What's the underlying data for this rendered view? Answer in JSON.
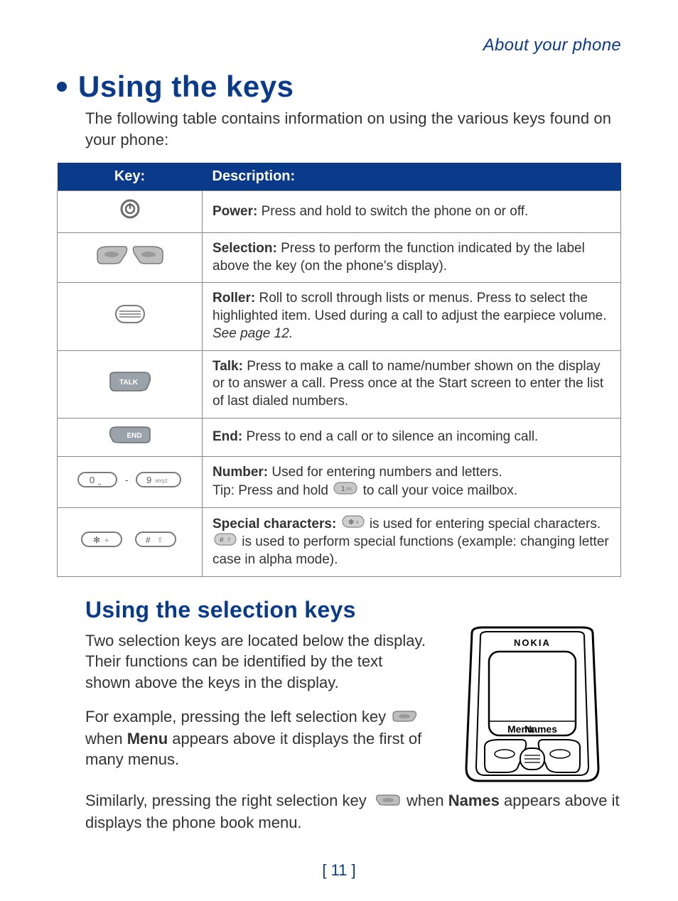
{
  "header": {
    "section": "About your phone"
  },
  "title": "Using the keys",
  "intro": "The following table contains information on using the various keys found on your phone:",
  "table": {
    "headers": {
      "key": "Key:",
      "desc": "Description:"
    },
    "rows": [
      {
        "icon": "power",
        "label": "Power:",
        "text": " Press and hold to switch the phone on or off."
      },
      {
        "icon": "selection",
        "label": "Selection:",
        "text": " Press to perform the function indicated by the label above the key (on the phone's display)."
      },
      {
        "icon": "roller",
        "label": "Roller:",
        "text": " Roll to scroll through lists or menus. Press to select the highlighted item. Used during a call to adjust the earpiece volume. ",
        "italic": "See page 12."
      },
      {
        "icon": "talk",
        "label": "Talk:",
        "text": "  Press to make a call to name/number shown on the display or to answer a call. Press once at the Start screen to enter the list of last dialed numbers."
      },
      {
        "icon": "end",
        "label": "End:",
        "text": " Press to end a call or to silence an incoming call."
      },
      {
        "icon": "number",
        "label": "Number:",
        "text": "  Used for entering numbers and letters.",
        "tip_prefix": "Tip:  Press and hold ",
        "tip_suffix": " to call your voice mailbox."
      },
      {
        "icon": "special",
        "label": "Special characters:",
        "text_a": " is used for entering special characters. ",
        "text_b": " is used to perform special functions (example: changing letter case in alpha mode)."
      }
    ]
  },
  "selection": {
    "heading": "Using the selection keys",
    "p1": "Two selection keys are located below the display. Their functions can be identified by the text shown above the keys in the display.",
    "p2_a": "For example, pressing the left selection key ",
    "p2_b": " when ",
    "p2_menu": "Menu",
    "p2_c": " appears above it displays the first of many menus.",
    "p3_a": "Similarly, pressing the right selection key ",
    "p3_b": " when ",
    "p3_names": "Names",
    "p3_c": " appears above it displays the phone book menu.",
    "fig": {
      "brand": "NOKIA",
      "left": "Menu",
      "right": "Names"
    }
  },
  "page_number": "[ 11 ]"
}
